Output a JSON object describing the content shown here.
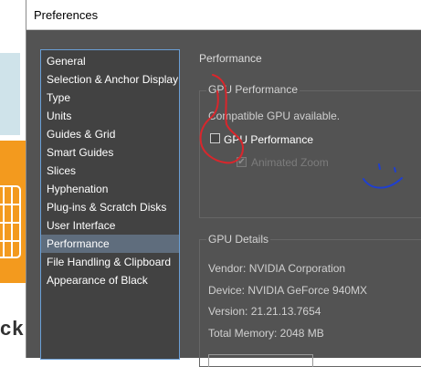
{
  "window": {
    "title": "Preferences"
  },
  "background_app": {
    "partial_text": "ckr"
  },
  "categories": [
    {
      "label": "General"
    },
    {
      "label": "Selection & Anchor Display"
    },
    {
      "label": "Type"
    },
    {
      "label": "Units"
    },
    {
      "label": "Guides & Grid"
    },
    {
      "label": "Smart Guides"
    },
    {
      "label": "Slices"
    },
    {
      "label": "Hyphenation"
    },
    {
      "label": "Plug-ins & Scratch Disks"
    },
    {
      "label": "User Interface"
    },
    {
      "label": "Performance",
      "selected": true
    },
    {
      "label": "File Handling & Clipboard"
    },
    {
      "label": "Appearance of Black"
    }
  ],
  "panel": {
    "section_title": "Performance",
    "gpu_performance": {
      "legend": "GPU Performance",
      "status": "Compatible GPU available.",
      "gpu_checkbox_label": "GPU Performance",
      "gpu_checked": false,
      "animated_zoom_label": "Animated Zoom",
      "animated_zoom_checked": true,
      "animated_zoom_enabled": false
    },
    "gpu_details": {
      "legend": "GPU Details",
      "vendor": "Vendor: NVIDIA Corporation",
      "device": "Device: NVIDIA GeForce 940MX",
      "version": "Version: 21.21.13.7654",
      "memory": "Total Memory: 2048 MB"
    }
  },
  "colors": {
    "dialog_bg": "#535353",
    "list_bg": "#424242",
    "selection": "#5f6d7d",
    "list_border": "#6a9fd6",
    "annotation_red": "#d9262c",
    "annotation_blue": "#1f3fd0",
    "bg_orange": "#f39a1e"
  }
}
